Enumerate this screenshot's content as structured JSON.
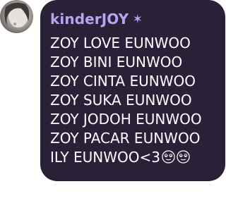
{
  "sender": {
    "name": "kinderJOY",
    "badge_glyph": "✶",
    "name_color": "#b9a3f2",
    "avatar_icon": "profile-photo"
  },
  "message": {
    "bubble_color": "#2a2139",
    "lines": [
      "ZOY LOVE EUNWOO",
      "ZOY BINI EUNWOO",
      "ZOY CINTA EUNWOO",
      "ZOY SUKA EUNWOO",
      "ZOY JODOH EUNWOO",
      "ZOY PACAR EUNWOO",
      "ILY EUNWOO<3"
    ],
    "trailing_emojis": [
      "swirl-eyes-emoji",
      "swirl-eyes-emoji"
    ]
  }
}
